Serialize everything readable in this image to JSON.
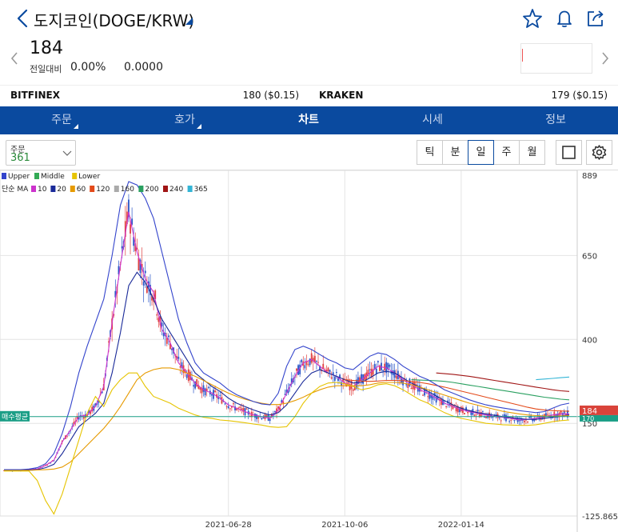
{
  "header": {
    "title": "도지코인(DOGE/KRW)"
  },
  "price": {
    "current": "184",
    "change_label": "전일대비",
    "change_pct": "0.00%",
    "change_amt": "0.0000"
  },
  "exchanges": [
    {
      "name": "BITFINEX",
      "price": "180 ($0.15)"
    },
    {
      "name": "KRAKEN",
      "price": "179 ($0.15)"
    }
  ],
  "tabs": [
    {
      "label": "주문",
      "has_dropdown": true
    },
    {
      "label": "호가",
      "has_dropdown": true
    },
    {
      "label": "차트",
      "active": true
    },
    {
      "label": "시세"
    },
    {
      "label": "정보"
    }
  ],
  "toolbar": {
    "order_label": "주문",
    "order_value": "361",
    "periods": [
      "틱",
      "분",
      "일",
      "주",
      "월"
    ],
    "active_period": "일"
  },
  "legend": {
    "bollinger": [
      {
        "label": "Upper",
        "color": "#3344cc"
      },
      {
        "label": "Middle",
        "color": "#33aa55"
      },
      {
        "label": "Lower",
        "color": "#e6c400"
      }
    ],
    "ma_title": "단순 MA",
    "ma": [
      {
        "label": "10",
        "color": "#cc33cc"
      },
      {
        "label": "20",
        "color": "#1a2a99"
      },
      {
        "label": "60",
        "color": "#e69a00"
      },
      {
        "label": "120",
        "color": "#e34a1a"
      },
      {
        "label": "160",
        "color": "#aaaaaa"
      },
      {
        "label": "200",
        "color": "#2aa060"
      },
      {
        "label": "240",
        "color": "#a01515"
      },
      {
        "label": "365",
        "color": "#33b5d6"
      }
    ]
  },
  "chart_data": {
    "type": "line",
    "title": "",
    "xlabel": "",
    "ylabel": "",
    "ylim": [
      -125.8656,
      889
    ],
    "y_ticks": [
      "889",
      "650",
      "400",
      "150",
      "-125.8656"
    ],
    "x_ticks": [
      "2021-06-28",
      "2021-10-06",
      "2022-01-14"
    ],
    "current_price_tag": "184",
    "secondary_price_tag": "170",
    "avg_buy_label": "매수평균",
    "avg_buy_value": 170,
    "x": [
      "2021-01-25",
      "2021-02-01",
      "2021-02-05",
      "2021-02-08",
      "2021-02-15",
      "2021-02-22",
      "2021-03-01",
      "2021-03-08",
      "2021-03-15",
      "2021-03-22",
      "2021-03-29",
      "2021-04-05",
      "2021-04-10",
      "2021-04-14",
      "2021-04-16",
      "2021-04-19",
      "2021-04-26",
      "2021-05-03",
      "2021-05-06",
      "2021-05-08",
      "2021-05-12",
      "2021-05-17",
      "2021-05-24",
      "2021-05-31",
      "2021-06-07",
      "2021-06-14",
      "2021-06-21",
      "2021-06-28",
      "2021-07-05",
      "2021-07-12",
      "2021-07-19",
      "2021-07-26",
      "2021-08-02",
      "2021-08-09",
      "2021-08-16",
      "2021-08-23",
      "2021-08-30",
      "2021-09-06",
      "2021-09-13",
      "2021-09-20",
      "2021-09-27",
      "2021-10-06",
      "2021-10-13",
      "2021-10-20",
      "2021-10-27",
      "2021-11-03",
      "2021-11-10",
      "2021-11-17",
      "2021-11-24",
      "2021-12-01",
      "2021-12-08",
      "2021-12-15",
      "2021-12-22",
      "2021-12-29",
      "2022-01-05",
      "2022-01-14",
      "2022-01-21",
      "2022-01-28",
      "2022-02-04",
      "2022-02-11",
      "2022-02-18",
      "2022-02-25",
      "2022-03-04",
      "2022-03-11",
      "2022-03-18",
      "2022-03-25",
      "2022-04-01",
      "2022-04-08",
      "2022-04-15"
    ],
    "series": [
      {
        "name": "10",
        "color": "#cc33cc",
        "values": [
          10,
          10,
          10,
          12,
          14,
          25,
          40,
          95,
          130,
          170,
          175,
          200,
          260,
          450,
          620,
          780,
          660,
          580,
          540,
          430,
          390,
          330,
          300,
          270,
          250,
          240,
          225,
          205,
          195,
          185,
          175,
          170,
          165,
          190,
          240,
          290,
          330,
          340,
          320,
          300,
          290,
          270,
          260,
          280,
          300,
          320,
          315,
          300,
          280,
          265,
          250,
          240,
          225,
          210,
          200,
          190,
          185,
          180,
          175,
          170,
          168,
          165,
          160,
          162,
          165,
          170,
          175,
          178,
          178
        ]
      },
      {
        "name": "20",
        "color": "#1a2a99",
        "values": [
          10,
          10,
          10,
          11,
          12,
          18,
          28,
          60,
          100,
          140,
          160,
          180,
          210,
          300,
          420,
          560,
          600,
          570,
          520,
          460,
          420,
          380,
          340,
          300,
          280,
          260,
          245,
          225,
          210,
          200,
          190,
          182,
          175,
          182,
          205,
          240,
          275,
          300,
          310,
          300,
          290,
          280,
          270,
          272,
          285,
          300,
          305,
          300,
          285,
          270,
          258,
          245,
          232,
          218,
          205,
          195,
          188,
          182,
          178,
          174,
          170,
          167,
          164,
          162,
          162,
          165,
          168,
          172,
          175
        ]
      },
      {
        "name": "60",
        "color": "#e69a00",
        "values": [
          10,
          10,
          10,
          10,
          11,
          12,
          14,
          20,
          35,
          60,
          85,
          110,
          135,
          165,
          200,
          240,
          280,
          300,
          310,
          315,
          315,
          310,
          300,
          290,
          278,
          265,
          252,
          240,
          230,
          222,
          215,
          210,
          206,
          206,
          210,
          218,
          228,
          240,
          250,
          258,
          262,
          262,
          262,
          262,
          265,
          270,
          272,
          272,
          270,
          265,
          258,
          250,
          242,
          234,
          226,
          218,
          210,
          204,
          198,
          192,
          186,
          182,
          178,
          175,
          173,
          172,
          171,
          172,
          173
        ]
      },
      {
        "name": "120",
        "color": "#e34a1a",
        "values": [
          null,
          null,
          null,
          null,
          null,
          null,
          null,
          null,
          null,
          null,
          null,
          null,
          null,
          null,
          null,
          null,
          null,
          null,
          null,
          null,
          null,
          null,
          null,
          null,
          null,
          null,
          null,
          null,
          null,
          null,
          null,
          null,
          null,
          null,
          null,
          null,
          null,
          null,
          null,
          null,
          null,
          280,
          278,
          276,
          275,
          276,
          278,
          278,
          277,
          275,
          272,
          268,
          263,
          258,
          252,
          246,
          240,
          234,
          228,
          222,
          216,
          210,
          204,
          198,
          193,
          190,
          188,
          187,
          186
        ]
      },
      {
        "name": "200",
        "color": "#2aa060",
        "values": [
          null,
          null,
          null,
          null,
          null,
          null,
          null,
          null,
          null,
          null,
          null,
          null,
          null,
          null,
          null,
          null,
          null,
          null,
          null,
          null,
          null,
          null,
          null,
          null,
          null,
          null,
          null,
          null,
          null,
          null,
          null,
          null,
          null,
          null,
          null,
          null,
          null,
          null,
          null,
          null,
          null,
          null,
          null,
          null,
          null,
          null,
          null,
          null,
          null,
          280,
          279,
          278,
          277,
          275,
          272,
          268,
          264,
          260,
          256,
          252,
          248,
          244,
          240,
          236,
          232,
          228,
          225,
          222,
          220
        ]
      },
      {
        "name": "240",
        "color": "#a01515",
        "values": [
          null,
          null,
          null,
          null,
          null,
          null,
          null,
          null,
          null,
          null,
          null,
          null,
          null,
          null,
          null,
          null,
          null,
          null,
          null,
          null,
          null,
          null,
          null,
          null,
          null,
          null,
          null,
          null,
          null,
          null,
          null,
          null,
          null,
          null,
          null,
          null,
          null,
          null,
          null,
          null,
          null,
          null,
          null,
          null,
          null,
          null,
          null,
          null,
          null,
          null,
          null,
          null,
          300,
          298,
          296,
          293,
          290,
          286,
          282,
          278,
          274,
          270,
          266,
          262,
          258,
          254,
          250,
          247,
          245
        ]
      },
      {
        "name": "365",
        "color": "#33b5d6",
        "values": [
          null,
          null,
          null,
          null,
          null,
          null,
          null,
          null,
          null,
          null,
          null,
          null,
          null,
          null,
          null,
          null,
          null,
          null,
          null,
          null,
          null,
          null,
          null,
          null,
          null,
          null,
          null,
          null,
          null,
          null,
          null,
          null,
          null,
          null,
          null,
          null,
          null,
          null,
          null,
          null,
          null,
          null,
          null,
          null,
          null,
          null,
          null,
          null,
          null,
          null,
          null,
          null,
          null,
          null,
          null,
          null,
          null,
          null,
          null,
          null,
          null,
          null,
          null,
          null,
          280,
          282,
          284,
          286,
          288
        ]
      },
      {
        "name": "Upper",
        "color": "#3344cc",
        "values": [
          12,
          12,
          12,
          14,
          18,
          30,
          60,
          120,
          200,
          300,
          380,
          450,
          520,
          650,
          800,
          870,
          860,
          820,
          760,
          660,
          560,
          460,
          390,
          330,
          300,
          285,
          270,
          250,
          235,
          225,
          215,
          208,
          205,
          240,
          320,
          370,
          380,
          370,
          355,
          340,
          330,
          315,
          310,
          330,
          350,
          360,
          355,
          340,
          320,
          305,
          290,
          280,
          265,
          250,
          240,
          230,
          220,
          212,
          205,
          200,
          196,
          192,
          188,
          185,
          182,
          185,
          195,
          205,
          210
        ]
      },
      {
        "name": "Lower",
        "color": "#e6c400",
        "values": [
          8,
          8,
          8,
          8,
          -20,
          -80,
          -120,
          -60,
          20,
          100,
          180,
          230,
          200,
          250,
          280,
          300,
          300,
          260,
          230,
          220,
          210,
          195,
          185,
          175,
          168,
          165,
          160,
          158,
          155,
          152,
          148,
          145,
          140,
          138,
          140,
          170,
          210,
          240,
          260,
          270,
          272,
          268,
          260,
          250,
          255,
          265,
          268,
          262,
          250,
          235,
          220,
          210,
          195,
          182,
          172,
          165,
          160,
          155,
          150,
          148,
          146,
          145,
          144,
          144,
          146,
          150,
          155,
          158,
          160
        ]
      }
    ]
  }
}
